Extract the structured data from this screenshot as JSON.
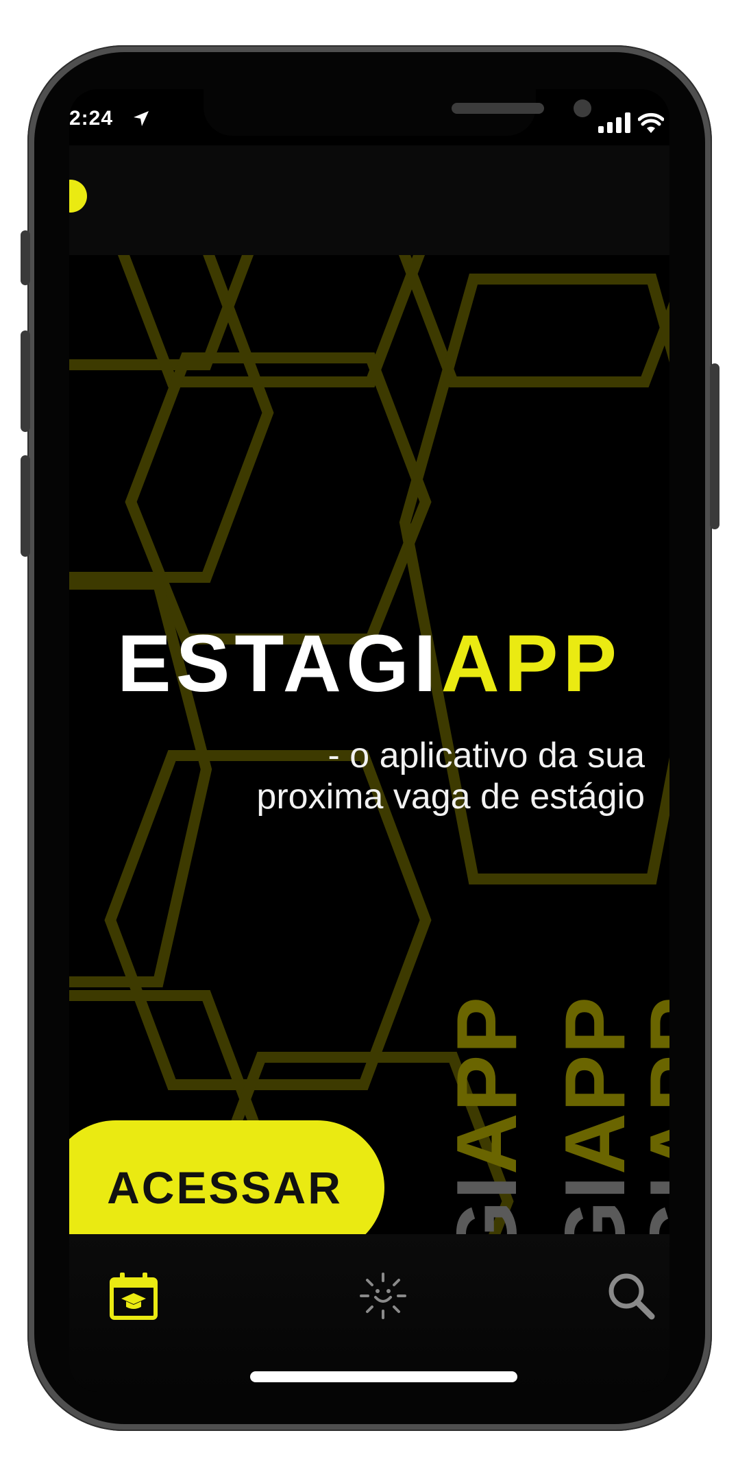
{
  "status_bar": {
    "time": "2:24"
  },
  "hero": {
    "title_white": "ESTAGI",
    "title_yellow": "APP",
    "subtitle_line1": "- o aplicativo da sua",
    "subtitle_line2": "proxima vaga de estágio",
    "cta_label": "ACESSAR",
    "deco_words": [
      {
        "yellow": "APP",
        "white": "GI"
      },
      {
        "yellow": "APP",
        "white": "GI"
      },
      {
        "yellow": "APP",
        "white": "GI"
      }
    ]
  },
  "tab_bar": {
    "tabs": [
      {
        "icon": "calendar-graduation-icon",
        "active": true
      },
      {
        "icon": "sun-smile-icon",
        "active": false
      },
      {
        "icon": "search-icon",
        "active": false
      }
    ]
  },
  "colors": {
    "accent": "#eaea12",
    "background": "#000000",
    "text": "#ffffff"
  }
}
